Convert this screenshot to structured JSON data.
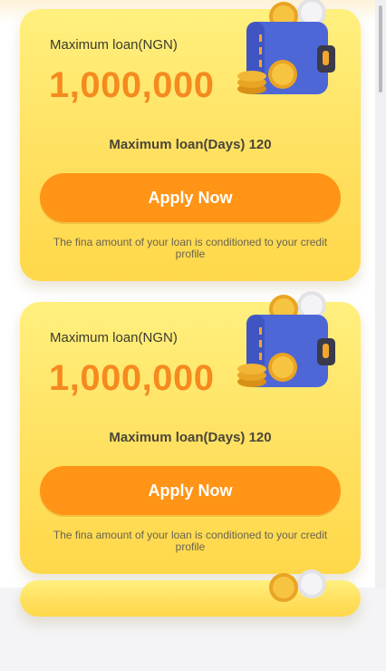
{
  "cards": [
    {
      "label": "Maximum loan(NGN)",
      "amount": "1,000,000",
      "days_line": "Maximum loan(Days) 120",
      "apply_label": "Apply Now",
      "note": "The fina amount of your loan is conditioned to your credit profile"
    },
    {
      "label": "Maximum loan(NGN)",
      "amount": "1,000,000",
      "days_line": "Maximum loan(Days) 120",
      "apply_label": "Apply Now",
      "note": "The fina amount of your loan is conditioned to your credit profile"
    }
  ],
  "icons": {
    "wallet": "wallet-with-coins-icon"
  },
  "colors": {
    "accent": "#ff9416",
    "amount": "#f58a1f",
    "card_top": "#fff07e",
    "card_bottom": "#ffd84a"
  }
}
